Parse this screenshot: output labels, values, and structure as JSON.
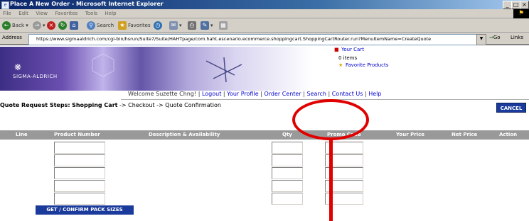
{
  "window": {
    "title": "Place A New Order - Microsoft Internet Explorer",
    "controls": [
      "_",
      "□",
      "×"
    ]
  },
  "menubar": {
    "items": [
      "File",
      "Edit",
      "View",
      "Favorites",
      "Tools",
      "Help"
    ]
  },
  "toolbar": {
    "back_label": "Back",
    "search_label": "Search",
    "favorites_label": "Favorites"
  },
  "addressbar": {
    "label": "Address",
    "url": "https://www.sigmaaldrich.com/cgi-bin/hsrun/Suite7/Suite/HAHTpage/com.haht.escenario.ecommerce.shoppingcart.ShoppingCartRouter.run?MenuItemName=CreateQuote",
    "go_label": "Go",
    "links_label": "Links"
  },
  "banner": {
    "logo_text": "SIGMA-ALDRICH",
    "cart_label": "Your Cart",
    "cart_items": "0 items",
    "favorites_label": "Favorite Products"
  },
  "nav": {
    "welcome": "Welcome Suzette Chng!",
    "links": [
      "Logout",
      "Your Profile",
      "Order Center",
      "Search",
      "Contact Us",
      "Help"
    ]
  },
  "steps": {
    "label": "Quote Request Steps:",
    "current": "Shopping Cart",
    "sep1": "->",
    "step2": "Checkout",
    "sep2": "->",
    "step3": "Quote Confirmation"
  },
  "cancel_label": "CANCEL",
  "table": {
    "columns": [
      "Line",
      "Product Number",
      "Description & Availability",
      "Qty",
      "Promo Code",
      "Your Price",
      "Net Price",
      "Action"
    ],
    "row_count": 5
  },
  "pack_button_label": "GET / CONFIRM PACK SIZES",
  "colors": {
    "button_blue": "#1a3b9c",
    "annotation_red": "#e00000",
    "header_gray": "#999999"
  }
}
